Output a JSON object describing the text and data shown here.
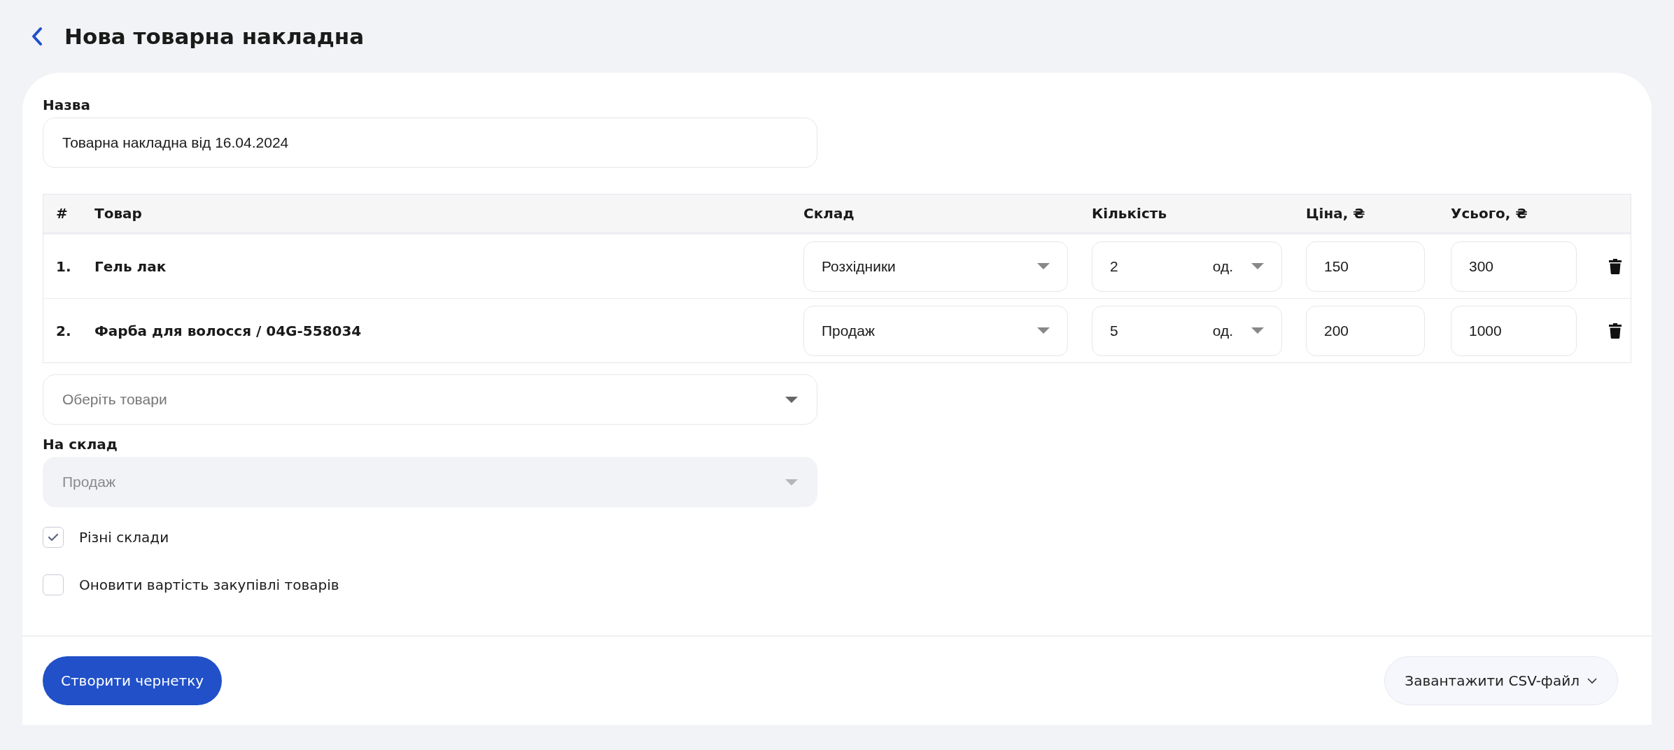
{
  "header": {
    "title": "Нова товарна накладна"
  },
  "name_field": {
    "label": "Назва",
    "value": "Товарна накладна від 16.04.2024"
  },
  "table": {
    "columns": [
      "#",
      "Товар",
      "Склад",
      "Кількість",
      "Ціна, ₴",
      "Усього, ₴"
    ],
    "rows": [
      {
        "number": "1.",
        "product": "Гель лак",
        "warehouse": "Розхідники",
        "quantity": "2",
        "unit": "од.",
        "price": "150",
        "total": "300"
      },
      {
        "number": "2.",
        "product": "Фарба для волосся / 04G-558034",
        "warehouse": "Продаж",
        "quantity": "5",
        "unit": "од.",
        "price": "200",
        "total": "1000"
      }
    ]
  },
  "product_select": {
    "placeholder": "Оберіть товари"
  },
  "target_warehouse": {
    "label": "На склад",
    "value": "Продаж",
    "disabled": true
  },
  "checkboxes": [
    {
      "label": "Різні склади",
      "checked": true
    },
    {
      "label": "Оновити вартість закупівлі товарів",
      "checked": false
    }
  ],
  "footer": {
    "primary_button": "Створити чернетку",
    "upload_button": "Завантажити CSV-файл"
  }
}
